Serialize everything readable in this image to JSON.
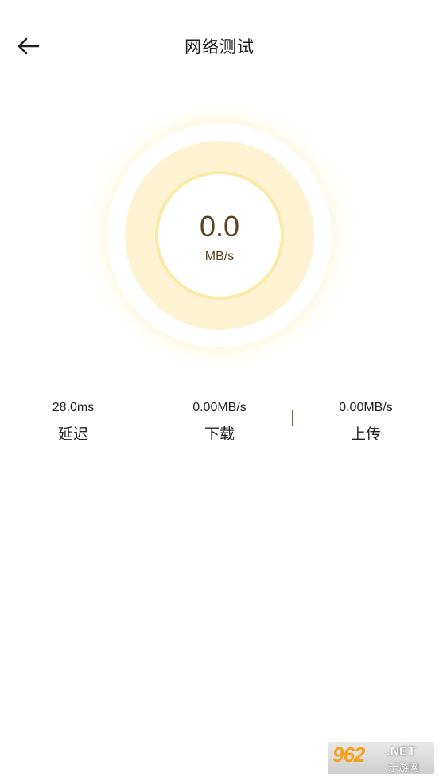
{
  "header": {
    "title": "网络测试",
    "back_icon": "arrow-left-icon"
  },
  "gauge": {
    "speed_value": "0.0",
    "speed_unit": "MB/s",
    "colors": {
      "outer_glow": "#fff3cf",
      "cream_ring": "#fdf3d3",
      "inner_ring_border": "#fbe9a6",
      "value_text": "#5a4320"
    }
  },
  "stats": [
    {
      "value": "28.0ms",
      "label": "延迟"
    },
    {
      "value": "0.00MB/s",
      "label": "下载"
    },
    {
      "value": "0.00MB/s",
      "label": "上传"
    }
  ],
  "watermark": {
    "number": "962",
    "suffix": ".NET",
    "sub": "乐游网"
  }
}
